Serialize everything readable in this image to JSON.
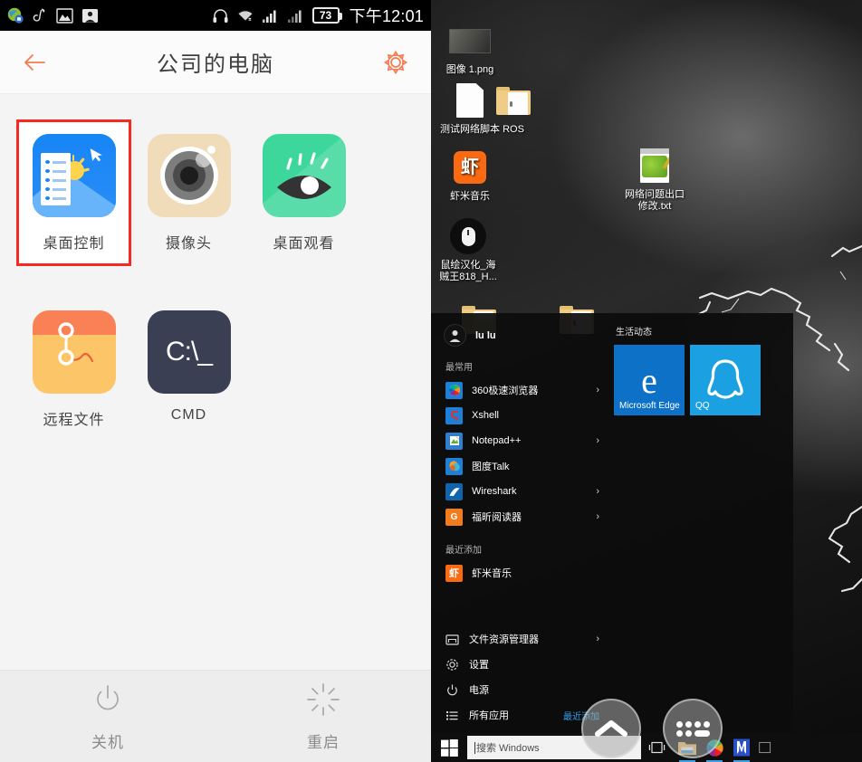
{
  "phone": {
    "statusbar": {
      "left_icons": [
        "app-globe-icon",
        "netease-music-icon",
        "gallery-image-icon",
        "person-photo-icon"
      ],
      "right_icons": [
        "headphone-icon",
        "wifi-icon",
        "signal-sim1-icon",
        "signal-sim2-icon"
      ],
      "battery_level": "73",
      "time": "下午12:01"
    },
    "appbar": {
      "back_icon": "back-arrow-icon",
      "title": "公司的电脑",
      "settings_icon": "gear-icon",
      "accent_color": "#f47b52"
    },
    "apps": [
      {
        "label": "桌面控制",
        "icon": "remote-desktop-control-icon",
        "selected": true
      },
      {
        "label": "摄像头",
        "icon": "camera-icon",
        "selected": false
      },
      {
        "label": "桌面观看",
        "icon": "desktop-view-eye-icon",
        "selected": false
      },
      {
        "label": "远程文件",
        "icon": "remote-file-icon",
        "selected": false
      },
      {
        "label": "CMD",
        "icon": "cmd-console-icon",
        "selected": false
      }
    ],
    "cmd_icon_text": "C:\\_",
    "bottom_actions": [
      {
        "label": "关机",
        "icon": "power-off-icon"
      },
      {
        "label": "重启",
        "icon": "restart-icon"
      }
    ],
    "highlight_color": "#f72a21"
  },
  "pc": {
    "desktop_icons": [
      {
        "name": "图像 1.png",
        "icon": "image-thumbnail-icon"
      },
      {
        "name": "测试网络脚本",
        "icon": "white-document-icon"
      },
      {
        "name": "ROS",
        "icon": "folder-icon"
      },
      {
        "name": "虾米音乐",
        "icon": "xiami-music-icon",
        "glyph": "虾"
      },
      {
        "name": "鼠绘汉化_海贼王818_H...",
        "icon": "mouse-shortcut-icon"
      },
      {
        "name": "网络问题出口修改.txt",
        "icon": "text-file-icon"
      }
    ],
    "start_menu": {
      "user": {
        "name": "lu lu",
        "avatar": "user-avatar-icon"
      },
      "sections": [
        {
          "title": "最常用",
          "items": [
            {
              "label": "360极速浏览器",
              "icon": "360-browser-icon",
              "color": "#1d7fd6",
              "glyph": "◕",
              "chevron": "›"
            },
            {
              "label": "Xshell",
              "icon": "xshell-icon",
              "color": "#1d7fd6",
              "glyph": "S",
              "chevron": ""
            },
            {
              "label": "Notepad++",
              "icon": "notepadpp-icon",
              "color": "#2f7fd0",
              "glyph": "▤",
              "chevron": "›"
            },
            {
              "label": "图度Talk",
              "icon": "baidu-talk-icon",
              "color": "#1d7fd6",
              "glyph": "●",
              "chevron": ""
            },
            {
              "label": "Wireshark",
              "icon": "wireshark-icon",
              "color": "#1168b0",
              "glyph": "◣",
              "chevron": "›"
            },
            {
              "label": "福昕阅读器",
              "icon": "foxit-reader-icon",
              "color": "#f07c1e",
              "glyph": "G",
              "chevron": "›"
            }
          ]
        },
        {
          "title": "最近添加",
          "items": [
            {
              "label": "虾米音乐",
              "icon": "xiami-music-icon",
              "color": "#f96a12",
              "glyph": "虾",
              "chevron": ""
            }
          ]
        }
      ],
      "bottom_items": [
        {
          "label": "文件资源管理器",
          "icon": "file-explorer-icon",
          "chevron": "›",
          "badge": ""
        },
        {
          "label": "设置",
          "icon": "settings-gear-icon",
          "chevron": "",
          "badge": ""
        },
        {
          "label": "电源",
          "icon": "power-icon",
          "chevron": "",
          "badge": ""
        },
        {
          "label": "所有应用",
          "icon": "all-apps-icon",
          "chevron": "",
          "badge": "最近添加"
        }
      ],
      "tile_group_title": "生活动态",
      "tiles": [
        {
          "label": "Microsoft Edge",
          "icon": "edge-icon",
          "color": "#0e71c8",
          "glyph": "e"
        },
        {
          "label": "QQ",
          "icon": "qq-penguin-icon",
          "color": "#1ba1e2",
          "glyph": ""
        }
      ]
    },
    "taskbar": {
      "start_icon": "windows-start-icon",
      "search_placeholder": "搜索 Windows",
      "taskview_icon": "task-view-icon",
      "pinned": [
        {
          "icon": "file-explorer-icon",
          "running": true
        },
        {
          "icon": "360-browser-icon",
          "running": true
        },
        {
          "icon": "wps-icon",
          "running": true
        },
        {
          "icon": "unknown-app-icon",
          "running": false
        }
      ]
    },
    "nav_overlay": [
      {
        "icon": "chevron-up-icon"
      },
      {
        "icon": "keyboard-icon"
      }
    ]
  }
}
